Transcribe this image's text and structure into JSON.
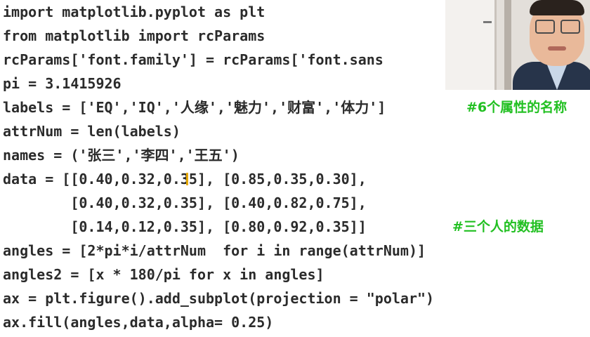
{
  "code_lines": [
    "import matplotlib.pyplot as plt",
    "from matplotlib import rcParams",
    "rcParams['font.family'] = rcParams['font.sans",
    "pi = 3.1415926",
    "labels = ['EQ','IQ','人缘','魅力','财富','体力']",
    "attrNum = len(labels)",
    "names = ('张三','李四','王五')",
    "data = [[0.40,0.32,0.35], [0.85,0.35,0.30],",
    "        [0.40,0.32,0.35], [0.40,0.82,0.75],",
    "        [0.14,0.12,0.35], [0.80,0.92,0.35]]",
    "angles = [2*pi*i/attrNum  for i in range(attrNum)]",
    "angles2 = [x * 180/pi for x in angles]",
    "ax = plt.figure().add_subplot(projection = \"polar\")",
    "ax.fill(angles,data,alpha= 0.25)"
  ],
  "comments": {
    "labels_comment": "#6个属性的名称",
    "data_comment": "#三个人的数据"
  },
  "colors": {
    "code_text": "#2b2b2b",
    "comment": "#22c022",
    "background": "#ffffff",
    "cursor": "#e6a800"
  },
  "webcam": {
    "visible": true,
    "subject": "presenter"
  }
}
